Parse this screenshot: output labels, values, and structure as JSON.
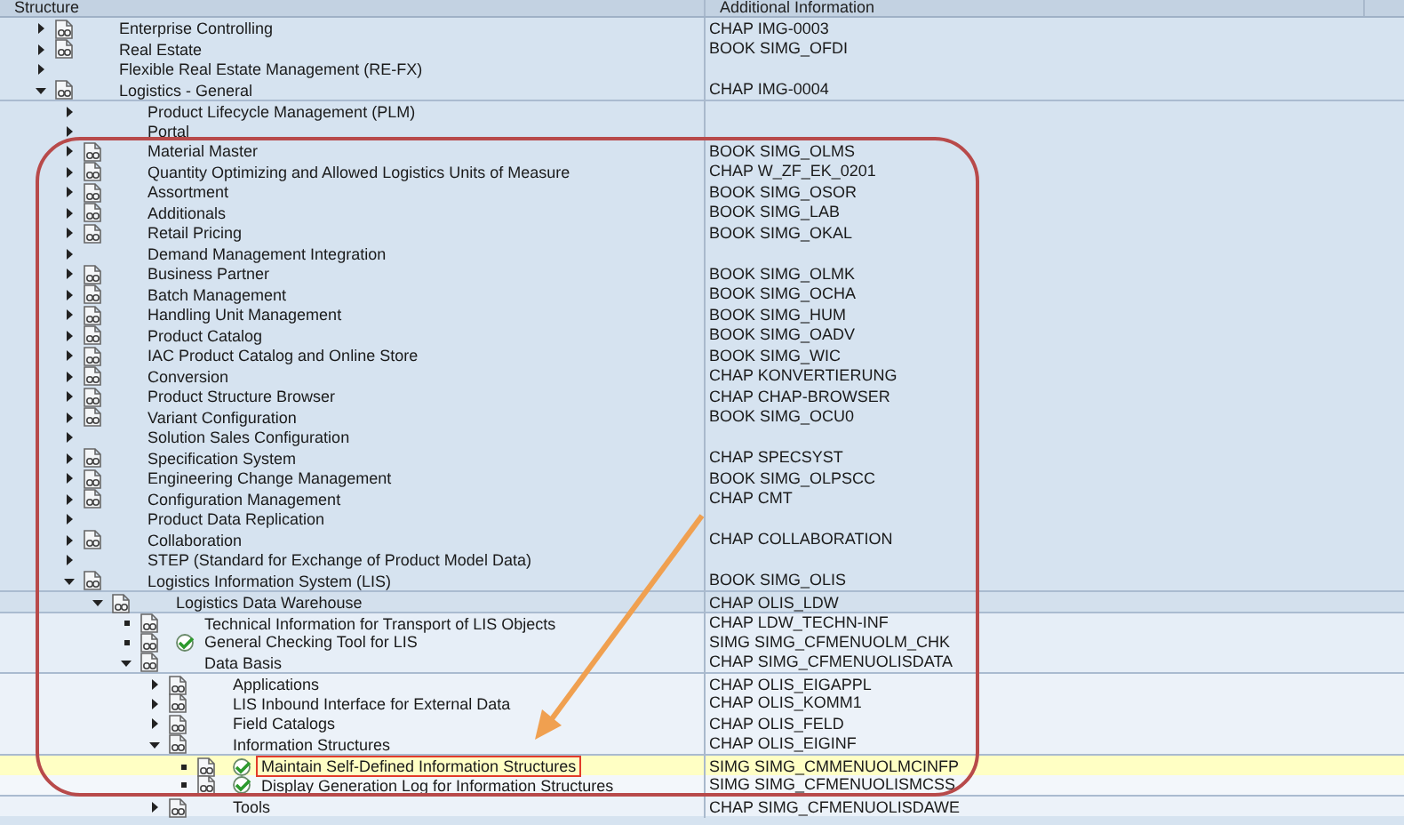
{
  "columns": [
    "Structure",
    "Additional Information"
  ],
  "tree": [
    {
      "label": "Enterprise Controlling",
      "info": "CHAP IMG-0003",
      "kind": "folder",
      "expanded": false,
      "doc": true,
      "execute": false,
      "selected": false
    },
    {
      "label": "Real Estate",
      "info": "BOOK SIMG_OFDI",
      "kind": "folder",
      "expanded": false,
      "doc": true,
      "execute": false,
      "selected": false
    },
    {
      "label": "Flexible Real Estate Management (RE-FX)",
      "kind": "folder",
      "expanded": false,
      "doc": false,
      "execute": false,
      "selected": false
    },
    {
      "label": "Logistics - General",
      "info": "CHAP IMG-0004",
      "kind": "folder",
      "expanded": true,
      "doc": true,
      "execute": false,
      "selected": false,
      "children": [
        {
          "label": "Product Lifecycle Management (PLM)",
          "kind": "folder",
          "expanded": false,
          "doc": false,
          "execute": false,
          "selected": false
        },
        {
          "label": "Portal",
          "kind": "folder",
          "expanded": false,
          "doc": false,
          "execute": false,
          "selected": false
        },
        {
          "label": "Material Master",
          "info": "BOOK SIMG_OLMS",
          "kind": "folder",
          "expanded": false,
          "doc": true,
          "execute": false,
          "selected": false
        },
        {
          "label": "Quantity Optimizing and Allowed Logistics Units of Measure",
          "info": "CHAP W_ZF_EK_0201",
          "kind": "folder",
          "expanded": false,
          "doc": true,
          "execute": false,
          "selected": false
        },
        {
          "label": "Assortment",
          "info": "BOOK SIMG_OSOR",
          "kind": "folder",
          "expanded": false,
          "doc": true,
          "execute": false,
          "selected": false
        },
        {
          "label": "Additionals",
          "info": "BOOK SIMG_LAB",
          "kind": "folder",
          "expanded": false,
          "doc": true,
          "execute": false,
          "selected": false
        },
        {
          "label": "Retail Pricing",
          "info": "BOOK SIMG_OKAL",
          "kind": "folder",
          "expanded": false,
          "doc": true,
          "execute": false,
          "selected": false
        },
        {
          "label": "Demand Management Integration",
          "kind": "folder",
          "expanded": false,
          "doc": false,
          "execute": false,
          "selected": false
        },
        {
          "label": "Business Partner",
          "info": "BOOK SIMG_OLMK",
          "kind": "folder",
          "expanded": false,
          "doc": true,
          "execute": false,
          "selected": false
        },
        {
          "label": "Batch Management",
          "info": "BOOK SIMG_OCHA",
          "kind": "folder",
          "expanded": false,
          "doc": true,
          "execute": false,
          "selected": false
        },
        {
          "label": "Handling Unit Management",
          "info": "BOOK SIMG_HUM",
          "kind": "folder",
          "expanded": false,
          "doc": true,
          "execute": false,
          "selected": false
        },
        {
          "label": "Product Catalog",
          "info": "BOOK SIMG_OADV",
          "kind": "folder",
          "expanded": false,
          "doc": true,
          "execute": false,
          "selected": false
        },
        {
          "label": "IAC Product Catalog and Online Store",
          "info": "BOOK SIMG_WIC",
          "kind": "folder",
          "expanded": false,
          "doc": true,
          "execute": false,
          "selected": false
        },
        {
          "label": "Conversion",
          "info": "CHAP KONVERTIERUNG",
          "kind": "folder",
          "expanded": false,
          "doc": true,
          "execute": false,
          "selected": false
        },
        {
          "label": "Product Structure Browser",
          "info": "CHAP CHAP-BROWSER",
          "kind": "folder",
          "expanded": false,
          "doc": true,
          "execute": false,
          "selected": false
        },
        {
          "label": "Variant Configuration",
          "info": "BOOK SIMG_OCU0",
          "kind": "folder",
          "expanded": false,
          "doc": true,
          "execute": false,
          "selected": false
        },
        {
          "label": "Solution Sales Configuration",
          "kind": "folder",
          "expanded": false,
          "doc": false,
          "execute": false,
          "selected": false
        },
        {
          "label": "Specification System",
          "info": "CHAP SPECSYST",
          "kind": "folder",
          "expanded": false,
          "doc": true,
          "execute": false,
          "selected": false
        },
        {
          "label": "Engineering Change Management",
          "info": "BOOK SIMG_OLPSCC",
          "kind": "folder",
          "expanded": false,
          "doc": true,
          "execute": false,
          "selected": false
        },
        {
          "label": "Configuration Management",
          "info": "CHAP CMT",
          "kind": "folder",
          "expanded": false,
          "doc": true,
          "execute": false,
          "selected": false
        },
        {
          "label": "Product Data Replication",
          "kind": "folder",
          "expanded": false,
          "doc": false,
          "execute": false,
          "selected": false
        },
        {
          "label": "Collaboration",
          "info": "CHAP COLLABORATION",
          "kind": "folder",
          "expanded": false,
          "doc": true,
          "execute": false,
          "selected": false
        },
        {
          "label": "STEP (Standard for Exchange of Product Model Data)",
          "kind": "folder",
          "expanded": false,
          "doc": false,
          "execute": false,
          "selected": false
        },
        {
          "label": "Logistics Information System (LIS)",
          "info": "BOOK SIMG_OLIS",
          "kind": "folder",
          "expanded": true,
          "doc": true,
          "execute": false,
          "selected": false,
          "children": [
            {
              "label": "Logistics Data Warehouse",
              "info": "CHAP OLIS_LDW",
              "kind": "folder",
              "expanded": true,
              "doc": true,
              "execute": false,
              "selected": false,
              "children": [
                {
                  "label": "Technical Information for Transport of LIS Objects",
                  "info": "CHAP LDW_TECHN-INF",
                  "kind": "leaf",
                  "doc": true,
                  "execute": false,
                  "selected": false
                },
                {
                  "label": "General Checking Tool for LIS",
                  "info": "SIMG SIMG_CFMENUOLM_CHK",
                  "kind": "leaf",
                  "doc": true,
                  "execute": true,
                  "selected": false
                },
                {
                  "label": "Data Basis",
                  "info": "CHAP SIMG_CFMENUOLISDATA",
                  "kind": "folder",
                  "expanded": true,
                  "doc": true,
                  "execute": false,
                  "selected": false,
                  "children": [
                    {
                      "label": "Applications",
                      "info": "CHAP OLIS_EIGAPPL",
                      "kind": "folder",
                      "expanded": false,
                      "doc": true,
                      "execute": false,
                      "selected": false
                    },
                    {
                      "label": "LIS Inbound Interface for External Data",
                      "info": "CHAP OLIS_KOMM1",
                      "kind": "folder",
                      "expanded": false,
                      "doc": true,
                      "execute": false,
                      "selected": false
                    },
                    {
                      "label": "Field Catalogs",
                      "info": "CHAP OLIS_FELD",
                      "kind": "folder",
                      "expanded": false,
                      "doc": true,
                      "execute": false,
                      "selected": false
                    },
                    {
                      "label": "Information Structures",
                      "info": "CHAP OLIS_EIGINF",
                      "kind": "folder",
                      "expanded": true,
                      "doc": true,
                      "execute": false,
                      "selected": false,
                      "children": [
                        {
                          "label": "Maintain Self-Defined Information Structures",
                          "info": "SIMG SIMG_CMMENUOLMCINFP",
                          "kind": "leaf",
                          "doc": true,
                          "execute": true,
                          "selected": true
                        },
                        {
                          "label": "Display Generation Log for Information Structures",
                          "info": "SIMG SIMG_CFMENUOLISMCSS",
                          "kind": "leaf",
                          "doc": true,
                          "execute": true,
                          "selected": false
                        }
                      ]
                    },
                    {
                      "label": "Tools",
                      "info": "CHAP SIMG_CFMENUOLISDAWE",
                      "kind": "folder",
                      "expanded": false,
                      "doc": true,
                      "execute": false,
                      "selected": false
                    }
                  ]
                }
              ]
            }
          ]
        }
      ]
    }
  ]
}
